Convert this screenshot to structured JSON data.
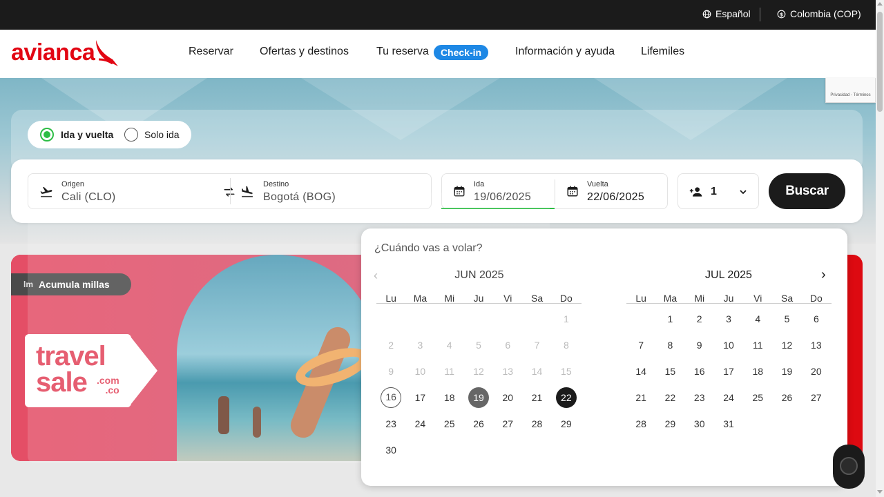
{
  "topbar": {
    "language": "Español",
    "currency": "Colombia (COP)"
  },
  "header": {
    "logo_text": "avianca",
    "nav": [
      "Reservar",
      "Ofertas y destinos",
      "Tu reserva",
      "Información y ayuda",
      "Lifemiles"
    ],
    "checkin_badge": "Check-in"
  },
  "recaptcha": {
    "text": "Privacidad - Términos"
  },
  "trip_type": {
    "options": [
      "Ida y vuelta",
      "Solo ida"
    ],
    "selected": "Ida y vuelta"
  },
  "search": {
    "origin_label": "Origen",
    "origin_value": "Cali  (CLO)",
    "destination_label": "Destino",
    "destination_value": "Bogotá  (BOG)",
    "depart_label": "Ida",
    "depart_value": "19/06/2025",
    "return_label": "Vuelta",
    "return_value": "22/06/2025",
    "passengers": "1",
    "search_button": "Buscar"
  },
  "banner": {
    "badge": "Acumula millas",
    "badge_icon_text": "lm",
    "tag_line1": "travel",
    "tag_line2": "sale",
    "tag_domain1": ".com",
    "tag_domain2": ".co"
  },
  "calendar": {
    "title": "¿Cuándo vas a volar?",
    "weekdays": [
      "Lu",
      "Ma",
      "Mi",
      "Ju",
      "Vi",
      "Sa",
      "Do"
    ],
    "months": [
      {
        "name": "JUN 2025",
        "lead_blanks": 6,
        "days": 30,
        "disabled_until": 15,
        "today": 16,
        "selected_start": 19,
        "selected_end": 22
      },
      {
        "name": "JUL 2025",
        "lead_blanks": 1,
        "days": 31,
        "disabled_until": 0,
        "today": 0,
        "selected_start": 0,
        "selected_end": 0
      }
    ]
  },
  "colors": {
    "brand_red": "#e20613",
    "accent_green": "#2dbd45",
    "checkin_blue": "#1e88e5",
    "dark": "#1b1b1b"
  }
}
